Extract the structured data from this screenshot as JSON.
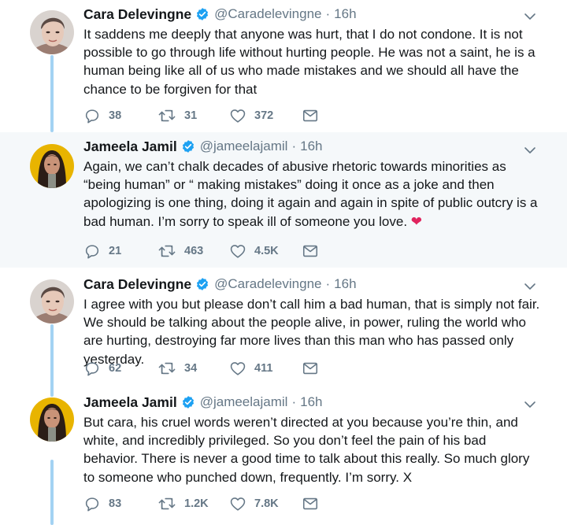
{
  "tweets": [
    {
      "name": "Cara Delevingne",
      "handle": "@Caradelevingne",
      "separator": "·",
      "time": "16h",
      "avatar": "cara-avatar",
      "highlight": false,
      "text": "It saddens me deeply that anyone was hurt, that I do not condone. It is not possible to go through life without hurting people. He was not a saint, he is a human being like all of us who made mistakes and we should all have the chance to be forgiven for that",
      "emoji": "",
      "replies": "38",
      "retweets": "31",
      "likes": "372"
    },
    {
      "name": "Jameela Jamil",
      "handle": "@jameelajamil",
      "separator": "·",
      "time": "16h",
      "avatar": "jameela-avatar",
      "highlight": true,
      "text": "Again, we can’t chalk decades of abusive rhetoric towards minorities as “being human” or “ making mistakes” doing it once as a joke and then apologizing is one thing, doing it again and again in spite of public outcry is a bad human. I’m sorry to speak ill of someone you love.",
      "emoji": "❤",
      "replies": "21",
      "retweets": "463",
      "likes": "4.5K"
    },
    {
      "name": "Cara Delevingne",
      "handle": "@Caradelevingne",
      "separator": "·",
      "time": "16h",
      "avatar": "cara-avatar",
      "highlight": false,
      "text": "I agree with you but please don’t call him a bad human, that is simply not fair. We should be talking about the people alive, in power, ruling the world who are hurting, destroying far more lives than this man who has passed only yesterday.",
      "emoji": "",
      "replies": "62",
      "retweets": "34",
      "likes": "411"
    },
    {
      "name": "Jameela Jamil",
      "handle": "@jameelajamil",
      "separator": "·",
      "time": "16h",
      "avatar": "jameela-avatar",
      "highlight": false,
      "text": "But cara, his cruel words weren’t directed at you because you’re thin, and white, and incredibly privileged. So you don’t feel the pain of his bad behavior. There is never a good time to talk about this really. So much glory to someone who punched down, frequently. I’m sorry. X",
      "emoji": "",
      "replies": "83",
      "retweets": "1.2K",
      "likes": "7.8K"
    }
  ],
  "colors": {
    "accent": "#1da1f2",
    "thread_line": "#a3d2f3",
    "muted": "#657786",
    "highlight_bg": "#f5f8fa",
    "heart": "#e0245e"
  },
  "icons": [
    "verified-badge-icon",
    "chevron-down-icon",
    "reply-icon",
    "retweet-icon",
    "like-icon",
    "direct-message-icon"
  ]
}
